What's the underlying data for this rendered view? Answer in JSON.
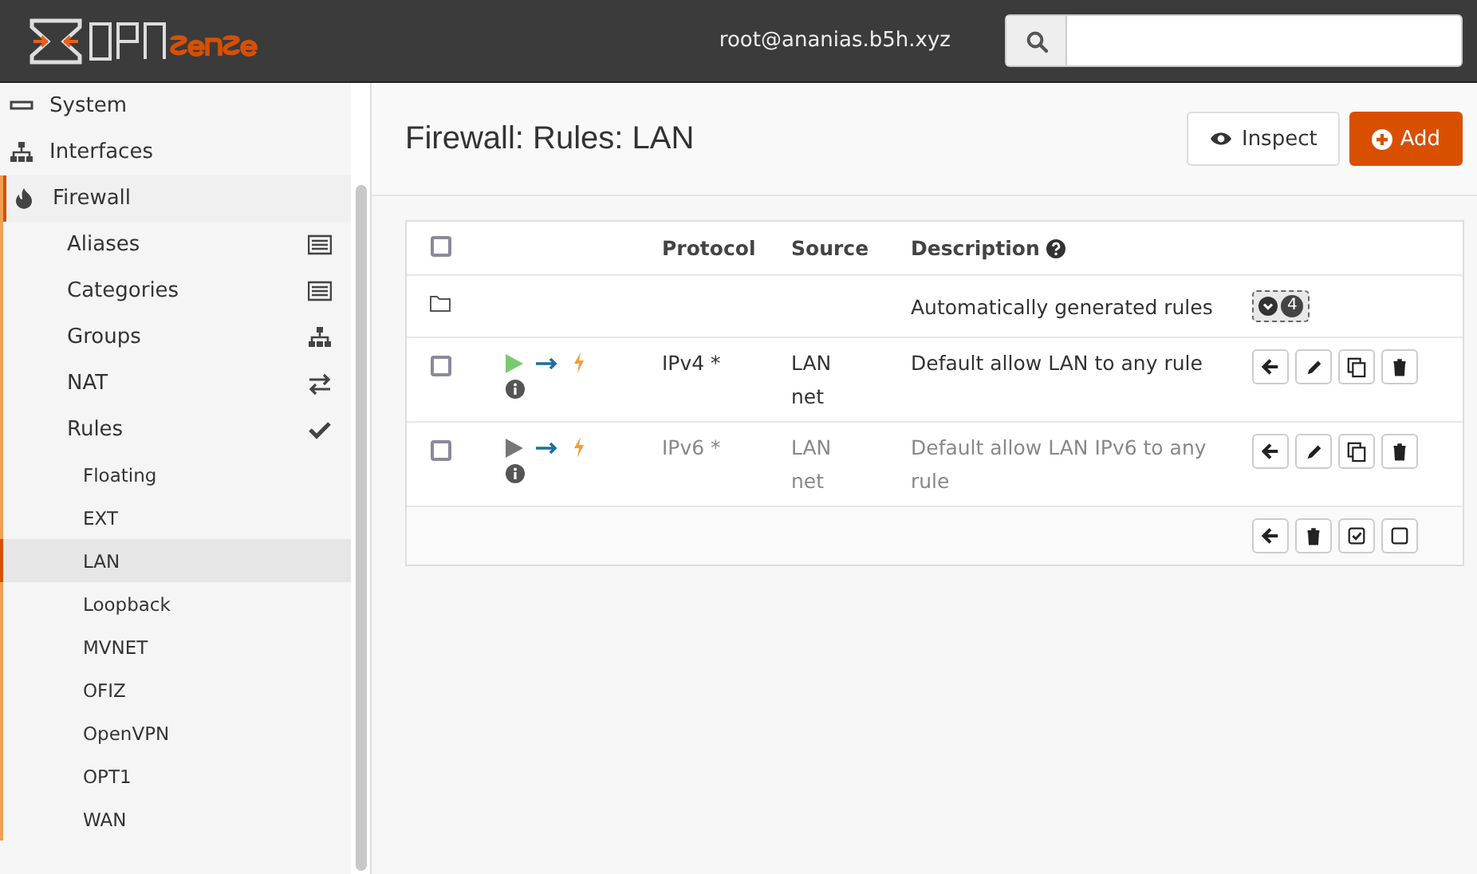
{
  "header": {
    "user": "root@ananias.b5h.xyz"
  },
  "sidebar": {
    "items": [
      {
        "label": "System",
        "selected": false
      },
      {
        "label": "Interfaces",
        "selected": false
      },
      {
        "label": "Firewall",
        "expanded": true,
        "selected": false,
        "children": [
          {
            "label": "Aliases",
            "selected": false
          },
          {
            "label": "Categories",
            "selected": false
          },
          {
            "label": "Groups",
            "selected": false
          },
          {
            "label": "NAT",
            "selected": false
          },
          {
            "label": "Rules",
            "expanded": true,
            "selected": false,
            "children": [
              {
                "label": "Floating",
                "selected": false
              },
              {
                "label": "EXT",
                "selected": false
              },
              {
                "label": "LAN",
                "selected": true
              },
              {
                "label": "Loopback",
                "selected": false
              },
              {
                "label": "MVNET",
                "selected": false
              },
              {
                "label": "OFIZ",
                "selected": false
              },
              {
                "label": "OpenVPN",
                "selected": false
              },
              {
                "label": "OPT1",
                "selected": false
              },
              {
                "label": "WAN",
                "selected": false
              }
            ]
          }
        ]
      }
    ]
  },
  "page": {
    "title": "Firewall: Rules: LAN",
    "buttons": [
      {
        "label": "Inspect",
        "kind": "inspect"
      },
      {
        "label": "Add",
        "kind": "add"
      }
    ]
  },
  "table": {
    "select_all": {
      "checked": false
    },
    "columns": [
      "Protocol",
      "Source",
      "Description"
    ],
    "group": {
      "label": "Automatically generated rules",
      "count": "4"
    },
    "rows": [
      {
        "checked": false,
        "enabled": true,
        "protocol": "IPv4 *",
        "source": "LAN net",
        "description": "Default allow LAN to any rule"
      },
      {
        "checked": false,
        "enabled": false,
        "protocol": "IPv6 *",
        "source": "LAN net",
        "description": "Default allow LAN IPv6 to any rule"
      }
    ]
  }
}
